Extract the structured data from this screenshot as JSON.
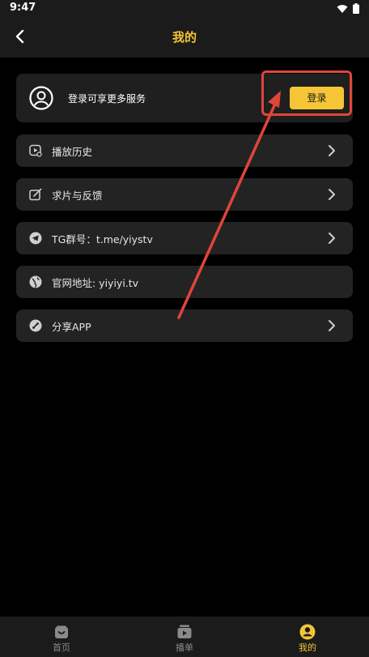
{
  "status_bar": {
    "time": "9:47"
  },
  "header": {
    "title": "我的"
  },
  "login_card": {
    "hint": "登录可享更多服务",
    "button_label": "登录"
  },
  "menu": {
    "items": [
      {
        "label": "播放历史",
        "icon": "play-history-icon",
        "has_chevron": true
      },
      {
        "label": "求片与反馈",
        "icon": "edit-icon",
        "has_chevron": true
      },
      {
        "label": "TG群号：t.me/yiystv",
        "icon": "telegram-icon",
        "has_chevron": true
      },
      {
        "label": "官网地址: yiyiyi.tv",
        "icon": "globe-icon",
        "has_chevron": false
      },
      {
        "label": "分享APP",
        "icon": "share-icon",
        "has_chevron": true
      }
    ]
  },
  "bottom_nav": {
    "tabs": [
      {
        "label": "首页",
        "icon": "home-icon",
        "active": false
      },
      {
        "label": "播单",
        "icon": "playlist-icon",
        "active": false
      },
      {
        "label": "我的",
        "icon": "profile-icon",
        "active": true
      }
    ]
  },
  "colors": {
    "accent": "#f5c437",
    "annotation": "#e0453a",
    "background": "#000000",
    "card": "#232323"
  }
}
